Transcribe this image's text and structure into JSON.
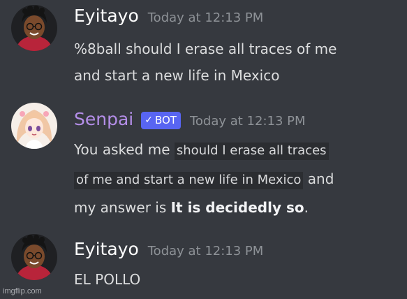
{
  "messages": [
    {
      "author": "Eyitayo",
      "timestamp": "Today at 12:13 PM",
      "avatar_icon": "user-avatar-icon",
      "lines": [
        "%8ball should I erase all traces of me",
        "and start a new life in Mexico"
      ]
    },
    {
      "author": "Senpai",
      "bot_tag": "BOT",
      "bot_check": "✓",
      "timestamp": "Today at 12:13 PM",
      "avatar_icon": "bot-avatar-icon",
      "line1_prefix": "You asked me",
      "line1_highlight": "should I erase all traces",
      "line2_highlight": "of me and start a new life in Mexico",
      "line2_suffix": "and",
      "line3_prefix": "my answer is",
      "line3_bold": "It is decidedly so",
      "line3_suffix": "."
    },
    {
      "author": "Eyitayo",
      "timestamp": "Today at 12:13 PM",
      "avatar_icon": "user-avatar-icon",
      "lines": [
        "EL POLLO"
      ]
    }
  ],
  "watermark": "imgflip.com",
  "colors": {
    "background": "#36393f",
    "bot_username": "#b48ee8",
    "bot_tag": "#5865f2",
    "timestamp": "#8e9297"
  }
}
